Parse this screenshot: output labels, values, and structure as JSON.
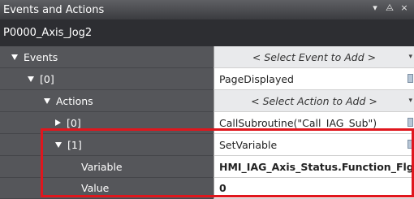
{
  "titlebar": {
    "title": "Events and Actions",
    "controls": [
      "▾",
      "⨺",
      "×"
    ]
  },
  "object": {
    "name": "P0000_Axis_Jog2"
  },
  "rows": [
    {
      "id": "events",
      "label": "Events",
      "value": "< Select Event to Add >",
      "expander": "expanded"
    },
    {
      "id": "event-0",
      "label": "[0]",
      "value": "PageDisplayed",
      "expander": "expanded"
    },
    {
      "id": "actions",
      "label": "Actions",
      "value": "< Select Action to Add >",
      "expander": "expanded"
    },
    {
      "id": "action-0",
      "label": "[0]",
      "value": "CallSubroutine(\"Call_IAG_Sub\")",
      "expander": "collapsed"
    },
    {
      "id": "action-1",
      "label": "[1]",
      "value": "SetVariable",
      "expander": "expanded"
    },
    {
      "id": "variable",
      "label": "Variable",
      "value": "HMI_IAG_Axis_Status.Function_Flg"
    },
    {
      "id": "value",
      "label": "Value",
      "value": "0"
    }
  ],
  "colors": {
    "highlight": "#e0161d",
    "row_label_bg": "#55565a",
    "titlebar_bg": "#3b3c40"
  }
}
